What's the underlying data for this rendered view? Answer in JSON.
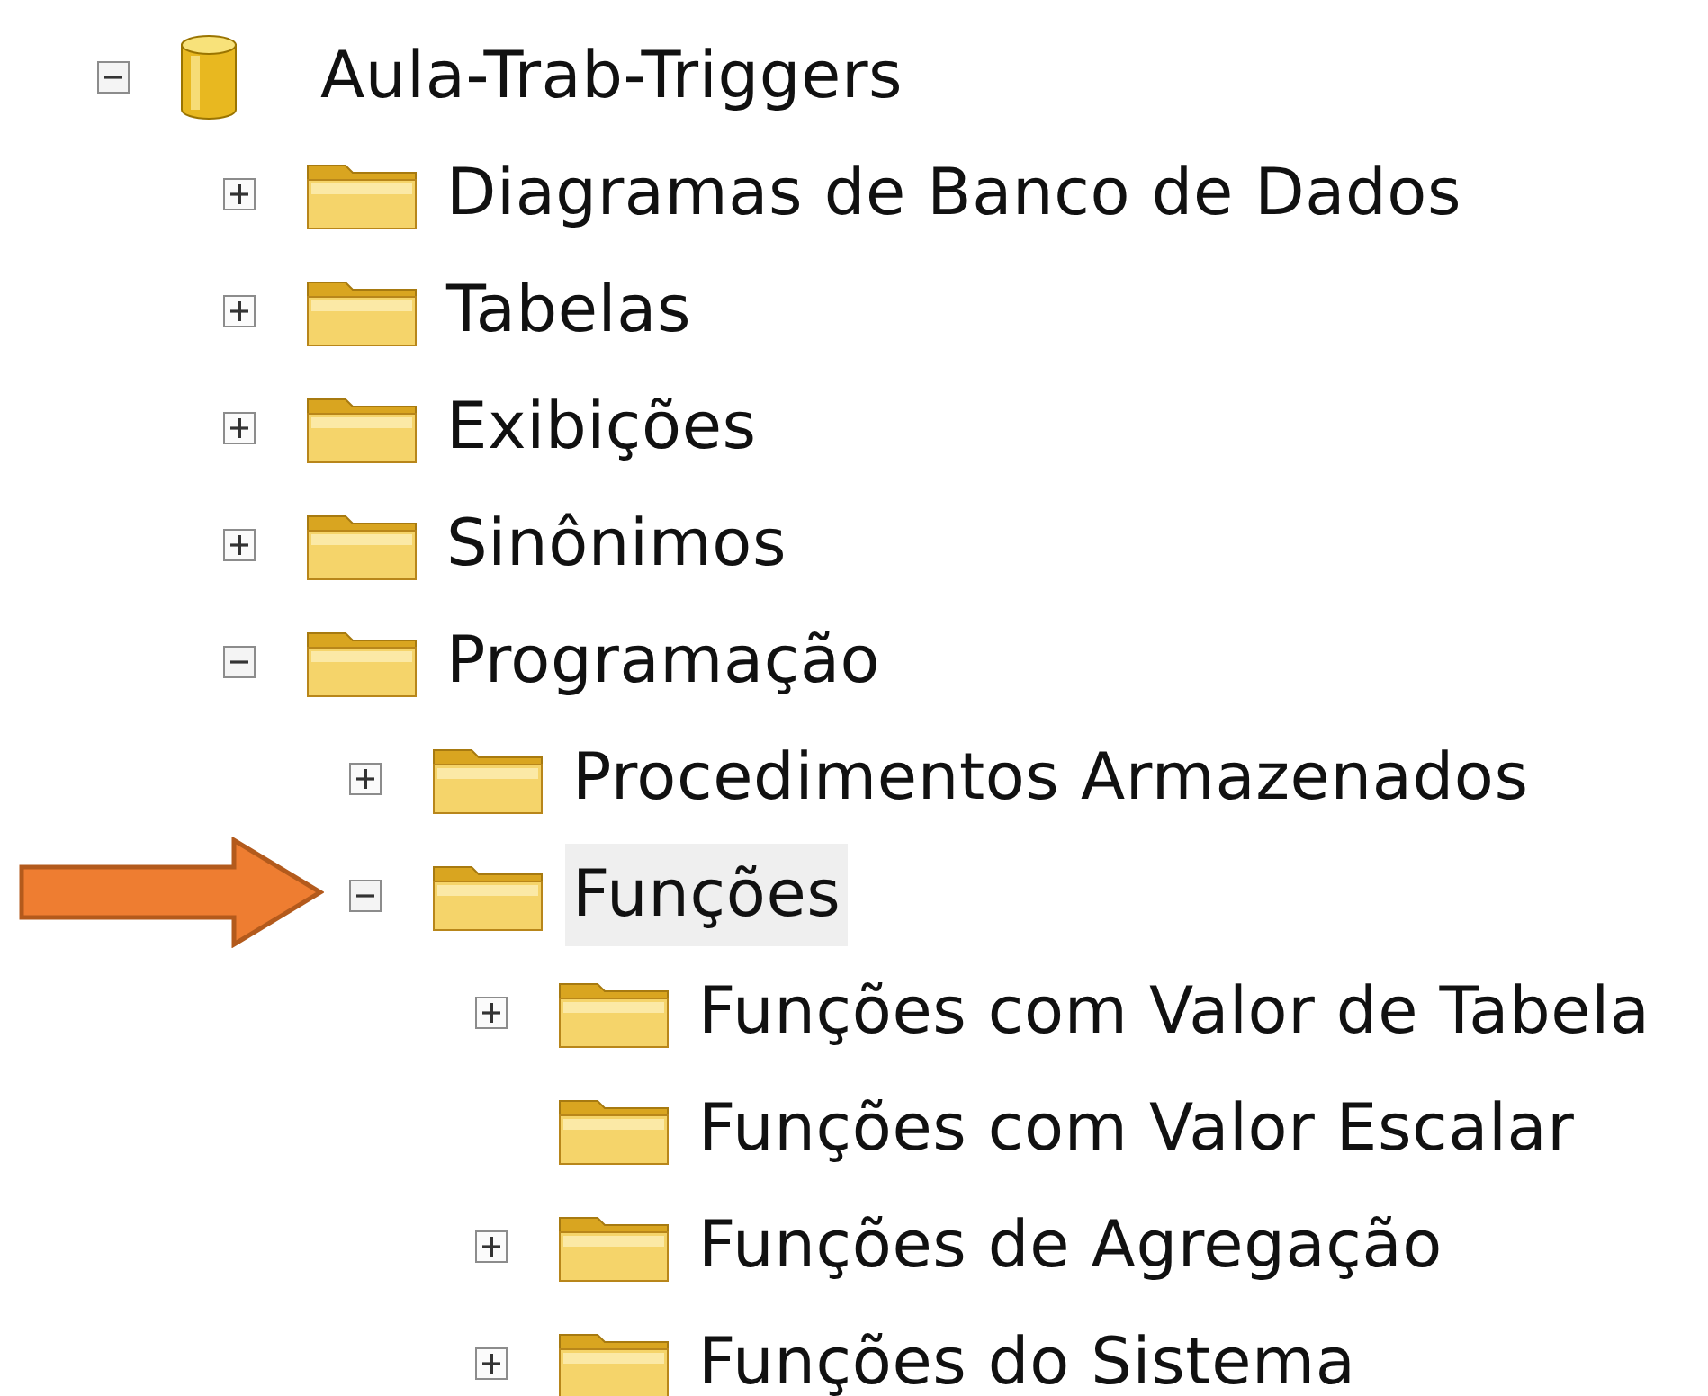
{
  "tree": [
    {
      "label": "Aula-Trab-Triggers",
      "kind": "database",
      "expandable": true,
      "expanded": true,
      "selected": false,
      "children": [
        {
          "label": "Diagramas de Banco de Dados",
          "kind": "folder",
          "expandable": true,
          "expanded": false,
          "selected": false
        },
        {
          "label": "Tabelas",
          "kind": "folder",
          "expandable": true,
          "expanded": false,
          "selected": false
        },
        {
          "label": "Exibições",
          "kind": "folder",
          "expandable": true,
          "expanded": false,
          "selected": false
        },
        {
          "label": "Sinônimos",
          "kind": "folder",
          "expandable": true,
          "expanded": false,
          "selected": false
        },
        {
          "label": "Programação",
          "kind": "folder",
          "expandable": true,
          "expanded": true,
          "selected": false,
          "children": [
            {
              "label": "Procedimentos Armazenados",
              "kind": "folder",
              "expandable": true,
              "expanded": false,
              "selected": false
            },
            {
              "label": "Funções",
              "kind": "folder",
              "expandable": true,
              "expanded": true,
              "selected": true,
              "children": [
                {
                  "label": "Funções com Valor de Tabela",
                  "kind": "folder",
                  "expandable": true,
                  "expanded": false,
                  "selected": false
                },
                {
                  "label": "Funções com Valor Escalar",
                  "kind": "folder",
                  "expandable": false,
                  "selected": false
                },
                {
                  "label": "Funções de Agregação",
                  "kind": "folder",
                  "expandable": true,
                  "expanded": false,
                  "selected": false
                },
                {
                  "label": "Funções do Sistema",
                  "kind": "folder",
                  "expandable": true,
                  "expanded": false,
                  "selected": false
                }
              ]
            }
          ]
        }
      ]
    }
  ]
}
